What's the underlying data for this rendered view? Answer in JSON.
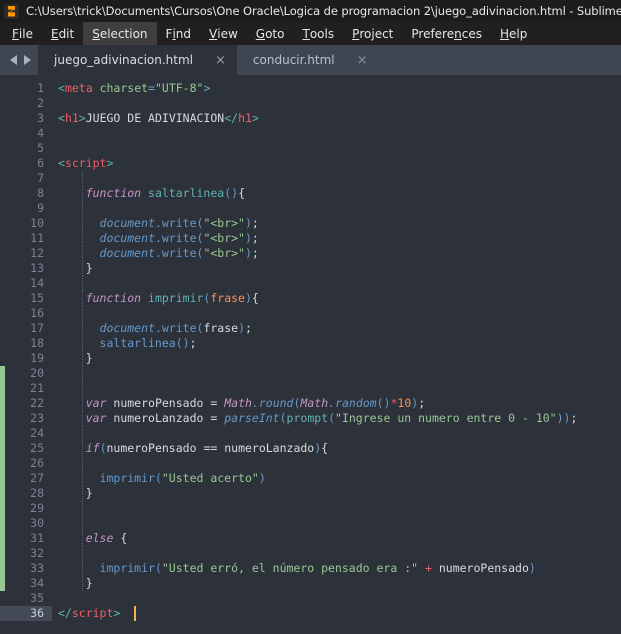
{
  "window": {
    "title": "C:\\Users\\trick\\Documents\\Cursos\\One Oracle\\Logica de programacion 2\\juego_adivinacion.html - Sublime Text",
    "logo_icon": "sublime-text-logo-icon"
  },
  "menubar": {
    "items": [
      {
        "label": "File",
        "pre": "",
        "mnemonic": "F",
        "post": "ile",
        "active": false
      },
      {
        "label": "Edit",
        "pre": "",
        "mnemonic": "E",
        "post": "dit",
        "active": false
      },
      {
        "label": "Selection",
        "pre": "",
        "mnemonic": "S",
        "post": "election",
        "active": true
      },
      {
        "label": "Find",
        "pre": "F",
        "mnemonic": "i",
        "post": "nd",
        "active": false
      },
      {
        "label": "View",
        "pre": "",
        "mnemonic": "V",
        "post": "iew",
        "active": false
      },
      {
        "label": "Goto",
        "pre": "",
        "mnemonic": "G",
        "post": "oto",
        "active": false
      },
      {
        "label": "Tools",
        "pre": "",
        "mnemonic": "T",
        "post": "ools",
        "active": false
      },
      {
        "label": "Project",
        "pre": "",
        "mnemonic": "P",
        "post": "roject",
        "active": false
      },
      {
        "label": "Preferences",
        "pre": "Prefere",
        "mnemonic": "n",
        "post": "ces",
        "active": false
      },
      {
        "label": "Help",
        "pre": "",
        "mnemonic": "H",
        "post": "elp",
        "active": false
      }
    ]
  },
  "tabbar": {
    "nav_prev_icon": "arrow-left-icon",
    "nav_next_icon": "arrow-right-icon",
    "close_glyph": "×",
    "tabs": [
      {
        "label": "juego_adivinacion.html",
        "selected": true
      },
      {
        "label": "conducir.html",
        "selected": false
      }
    ]
  },
  "editor": {
    "active_line": 36,
    "cursor": {
      "line": 36,
      "column": 11
    },
    "diff_marker": {
      "color": "#99c794",
      "from_line": 20,
      "to_line": 34
    },
    "lines": [
      {
        "n": 1,
        "tokens": [
          {
            "t": "<",
            "c": "t-punct"
          },
          {
            "t": "meta",
            "c": "t-tag"
          },
          {
            "t": " ",
            "c": "t-plain"
          },
          {
            "t": "charset",
            "c": "t-attr"
          },
          {
            "t": "=",
            "c": "t-punct"
          },
          {
            "t": "\"UTF-8\"",
            "c": "t-string"
          },
          {
            "t": ">",
            "c": "t-punct"
          }
        ],
        "indent": 0
      },
      {
        "n": 2,
        "tokens": [],
        "indent": 0
      },
      {
        "n": 3,
        "tokens": [
          {
            "t": "<",
            "c": "t-punct"
          },
          {
            "t": "h1",
            "c": "t-tag"
          },
          {
            "t": ">",
            "c": "t-punct"
          },
          {
            "t": "JUEGO DE ADIVINACION",
            "c": "t-plain"
          },
          {
            "t": "</",
            "c": "t-punct"
          },
          {
            "t": "h1",
            "c": "t-tag"
          },
          {
            "t": ">",
            "c": "t-punct"
          }
        ],
        "indent": 0
      },
      {
        "n": 4,
        "tokens": [],
        "indent": 0
      },
      {
        "n": 5,
        "tokens": [],
        "indent": 0
      },
      {
        "n": 6,
        "tokens": [
          {
            "t": "<",
            "c": "t-punct"
          },
          {
            "t": "script",
            "c": "t-tag"
          },
          {
            "t": ">",
            "c": "t-punct"
          }
        ],
        "indent": 0
      },
      {
        "n": 7,
        "tokens": [],
        "indent": 1
      },
      {
        "n": 8,
        "tokens": [
          {
            "t": "    ",
            "c": "t-plain"
          },
          {
            "t": "function",
            "c": "t-kw"
          },
          {
            "t": " ",
            "c": "t-plain"
          },
          {
            "t": "saltarlinea",
            "c": "t-support"
          },
          {
            "t": "(",
            "c": "t-fn"
          },
          {
            "t": ")",
            "c": "t-fn"
          },
          {
            "t": "{",
            "c": "t-plain"
          }
        ],
        "indent": 1
      },
      {
        "n": 9,
        "tokens": [],
        "indent": 1
      },
      {
        "n": 10,
        "tokens": [
          {
            "t": "      ",
            "c": "t-plain"
          },
          {
            "t": "document",
            "c": "t-fn-i"
          },
          {
            "t": ".",
            "c": "t-fn"
          },
          {
            "t": "write",
            "c": "t-fn"
          },
          {
            "t": "(",
            "c": "t-fn"
          },
          {
            "t": "\"<br>\"",
            "c": "t-string"
          },
          {
            "t": ")",
            "c": "t-fn"
          },
          {
            "t": ";",
            "c": "t-plain"
          }
        ],
        "indent": 1
      },
      {
        "n": 11,
        "tokens": [
          {
            "t": "      ",
            "c": "t-plain"
          },
          {
            "t": "document",
            "c": "t-fn-i"
          },
          {
            "t": ".",
            "c": "t-fn"
          },
          {
            "t": "write",
            "c": "t-fn"
          },
          {
            "t": "(",
            "c": "t-fn"
          },
          {
            "t": "\"<br>\"",
            "c": "t-string"
          },
          {
            "t": ")",
            "c": "t-fn"
          },
          {
            "t": ";",
            "c": "t-plain"
          }
        ],
        "indent": 1
      },
      {
        "n": 12,
        "tokens": [
          {
            "t": "      ",
            "c": "t-plain"
          },
          {
            "t": "document",
            "c": "t-fn-i"
          },
          {
            "t": ".",
            "c": "t-fn"
          },
          {
            "t": "write",
            "c": "t-fn"
          },
          {
            "t": "(",
            "c": "t-fn"
          },
          {
            "t": "\"<br>\"",
            "c": "t-string"
          },
          {
            "t": ")",
            "c": "t-fn"
          },
          {
            "t": ";",
            "c": "t-plain"
          }
        ],
        "indent": 1
      },
      {
        "n": 13,
        "tokens": [
          {
            "t": "    }",
            "c": "t-plain"
          }
        ],
        "indent": 1
      },
      {
        "n": 14,
        "tokens": [],
        "indent": 1
      },
      {
        "n": 15,
        "tokens": [
          {
            "t": "    ",
            "c": "t-plain"
          },
          {
            "t": "function",
            "c": "t-kw"
          },
          {
            "t": " ",
            "c": "t-plain"
          },
          {
            "t": "imprimir",
            "c": "t-support"
          },
          {
            "t": "(",
            "c": "t-fn"
          },
          {
            "t": "frase",
            "c": "t-param"
          },
          {
            "t": ")",
            "c": "t-fn"
          },
          {
            "t": "{",
            "c": "t-plain"
          }
        ],
        "indent": 1
      },
      {
        "n": 16,
        "tokens": [],
        "indent": 1
      },
      {
        "n": 17,
        "tokens": [
          {
            "t": "      ",
            "c": "t-plain"
          },
          {
            "t": "document",
            "c": "t-fn-i"
          },
          {
            "t": ".",
            "c": "t-fn"
          },
          {
            "t": "write",
            "c": "t-fn"
          },
          {
            "t": "(",
            "c": "t-fn"
          },
          {
            "t": "frase",
            "c": "t-plain"
          },
          {
            "t": ")",
            "c": "t-fn"
          },
          {
            "t": ";",
            "c": "t-plain"
          }
        ],
        "indent": 1
      },
      {
        "n": 18,
        "tokens": [
          {
            "t": "      ",
            "c": "t-plain"
          },
          {
            "t": "saltarlinea",
            "c": "t-fn"
          },
          {
            "t": "(",
            "c": "t-fn"
          },
          {
            "t": ")",
            "c": "t-fn"
          },
          {
            "t": ";",
            "c": "t-plain"
          }
        ],
        "indent": 1
      },
      {
        "n": 19,
        "tokens": [
          {
            "t": "    }",
            "c": "t-plain"
          }
        ],
        "indent": 1
      },
      {
        "n": 20,
        "tokens": [],
        "indent": 1
      },
      {
        "n": 21,
        "tokens": [],
        "indent": 1
      },
      {
        "n": 22,
        "tokens": [
          {
            "t": "    ",
            "c": "t-plain"
          },
          {
            "t": "var",
            "c": "t-kw"
          },
          {
            "t": " numeroPensado ",
            "c": "t-plain"
          },
          {
            "t": "=",
            "c": "t-plain"
          },
          {
            "t": " ",
            "c": "t-plain"
          },
          {
            "t": "Math",
            "c": "t-global"
          },
          {
            "t": ".",
            "c": "t-fn-i"
          },
          {
            "t": "round",
            "c": "t-fn-i"
          },
          {
            "t": "(",
            "c": "t-fn"
          },
          {
            "t": "Math",
            "c": "t-global"
          },
          {
            "t": ".",
            "c": "t-fn-i"
          },
          {
            "t": "random",
            "c": "t-fn-i"
          },
          {
            "t": "(",
            "c": "t-fn"
          },
          {
            "t": ")",
            "c": "t-fn"
          },
          {
            "t": "*",
            "c": "t-op"
          },
          {
            "t": "10",
            "c": "t-num"
          },
          {
            "t": ")",
            "c": "t-fn"
          },
          {
            "t": ";",
            "c": "t-plain"
          }
        ],
        "indent": 1
      },
      {
        "n": 23,
        "tokens": [
          {
            "t": "    ",
            "c": "t-plain"
          },
          {
            "t": "var",
            "c": "t-kw"
          },
          {
            "t": " numeroLanzado ",
            "c": "t-plain"
          },
          {
            "t": "=",
            "c": "t-plain"
          },
          {
            "t": " ",
            "c": "t-plain"
          },
          {
            "t": "parseInt",
            "c": "t-fn-i"
          },
          {
            "t": "(",
            "c": "t-fn"
          },
          {
            "t": "prompt",
            "c": "t-support"
          },
          {
            "t": "(",
            "c": "t-fn"
          },
          {
            "t": "\"Ingrese un numero entre 0 - 10\"",
            "c": "t-string"
          },
          {
            "t": ")",
            "c": "t-fn"
          },
          {
            "t": ")",
            "c": "t-fn"
          },
          {
            "t": ";",
            "c": "t-plain"
          }
        ],
        "indent": 1
      },
      {
        "n": 24,
        "tokens": [],
        "indent": 1
      },
      {
        "n": 25,
        "tokens": [
          {
            "t": "    ",
            "c": "t-plain"
          },
          {
            "t": "if",
            "c": "t-kw"
          },
          {
            "t": "(",
            "c": "t-fn"
          },
          {
            "t": "numeroPensado ",
            "c": "t-plain"
          },
          {
            "t": "==",
            "c": "t-plain"
          },
          {
            "t": " numeroLanzado",
            "c": "t-plain"
          },
          {
            "t": ")",
            "c": "t-fn"
          },
          {
            "t": "{",
            "c": "t-plain"
          }
        ],
        "indent": 1
      },
      {
        "n": 26,
        "tokens": [],
        "indent": 1
      },
      {
        "n": 27,
        "tokens": [
          {
            "t": "      ",
            "c": "t-plain"
          },
          {
            "t": "imprimir",
            "c": "t-fn"
          },
          {
            "t": "(",
            "c": "t-fn"
          },
          {
            "t": "\"Usted acerto\"",
            "c": "t-string"
          },
          {
            "t": ")",
            "c": "t-fn"
          }
        ],
        "indent": 1
      },
      {
        "n": 28,
        "tokens": [
          {
            "t": "    }",
            "c": "t-plain"
          }
        ],
        "indent": 1
      },
      {
        "n": 29,
        "tokens": [],
        "indent": 1
      },
      {
        "n": 30,
        "tokens": [],
        "indent": 1
      },
      {
        "n": 31,
        "tokens": [
          {
            "t": "    ",
            "c": "t-plain"
          },
          {
            "t": "else",
            "c": "t-kw"
          },
          {
            "t": " {",
            "c": "t-plain"
          }
        ],
        "indent": 1
      },
      {
        "n": 32,
        "tokens": [],
        "indent": 1
      },
      {
        "n": 33,
        "tokens": [
          {
            "t": "      ",
            "c": "t-plain"
          },
          {
            "t": "imprimir",
            "c": "t-fn"
          },
          {
            "t": "(",
            "c": "t-fn"
          },
          {
            "t": "\"Usted erró, el número pensado era :\"",
            "c": "t-string"
          },
          {
            "t": " ",
            "c": "t-plain"
          },
          {
            "t": "+",
            "c": "t-op"
          },
          {
            "t": " numeroPensado",
            "c": "t-plain"
          },
          {
            "t": ")",
            "c": "t-fn"
          }
        ],
        "indent": 1
      },
      {
        "n": 34,
        "tokens": [
          {
            "t": "    }",
            "c": "t-plain"
          }
        ],
        "indent": 1
      },
      {
        "n": 35,
        "tokens": [],
        "indent": 0
      },
      {
        "n": 36,
        "tokens": [
          {
            "t": "</",
            "c": "t-punct"
          },
          {
            "t": "script",
            "c": "t-tag"
          },
          {
            "t": ">",
            "c": "t-punct"
          }
        ],
        "indent": 0
      }
    ]
  }
}
